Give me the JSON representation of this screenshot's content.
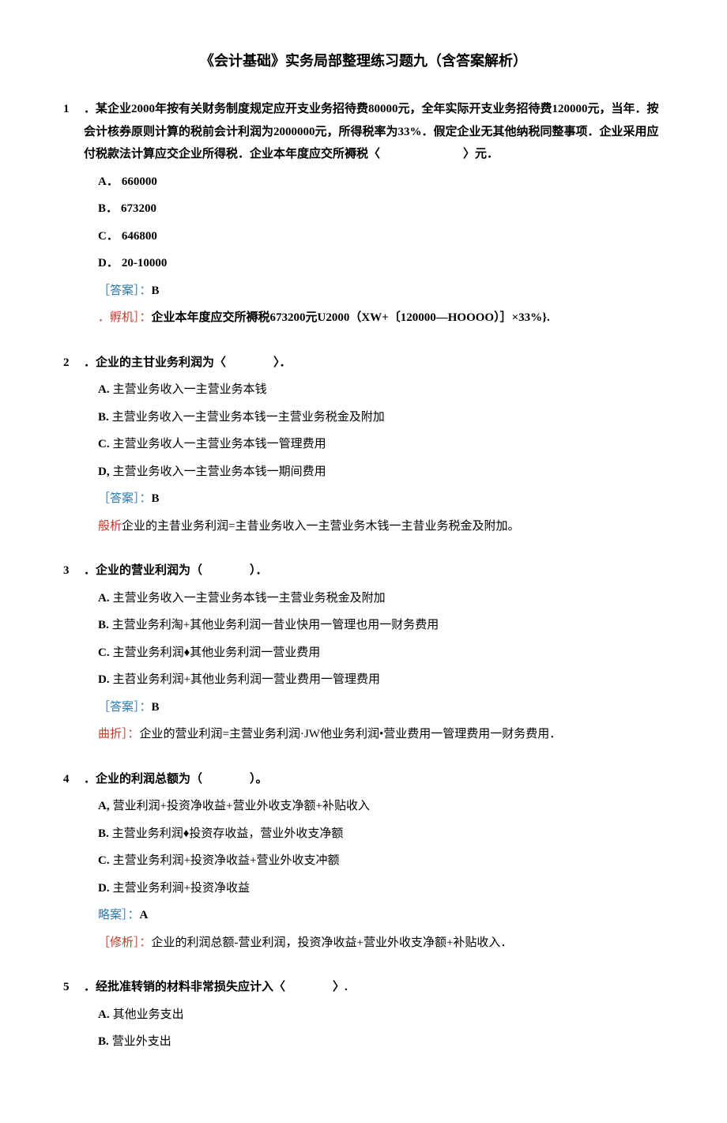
{
  "title": "《会计基础》实务局部整理练习题九（含答案解析）",
  "questions": [
    {
      "num": "1",
      "stem": "．某企业2000年按有关财务制度规定应开支业务招待费80000元，全年实际开支业务招待费120000元，当年．按会计核券原则计算的税前会计利润为2000000元，所得税率为33%．假定企业无其他纳税同整事项．企业采用应付税款法计算应交企业所得税．企业本年度应交所褥税〈　　　　　　　〉元．",
      "options": [
        {
          "label": "A．",
          "text": "660000"
        },
        {
          "label": "B．",
          "text": "673200"
        },
        {
          "label": "C．",
          "text": "646800"
        },
        {
          "label": "D．",
          "text": "20-10000"
        }
      ],
      "answer_label": "［答案］：",
      "answer": "B",
      "analysis_label": "．孵机］：",
      "analysis": "企业本年度应交所褥税673200元U2000（XW+〔120000—HOOOO）］×33%}."
    },
    {
      "num": "2",
      "stem": "．企业的主甘业务利润为〈　　　　〉．",
      "options": [
        {
          "label": "A.",
          "text": "主营业务收入一主营业务本钱"
        },
        {
          "label": "B.",
          "text": "主营业务收入一主营业务本钱一主营业务税金及附加"
        },
        {
          "label": "C.",
          "text": "主营业务收人一主营业务本钱一管理费用"
        },
        {
          "label": "D,",
          "text": "主营业务收入一主营业务本钱一期间费用"
        }
      ],
      "answer_label": "［答案］：",
      "answer": "B",
      "analysis_label": "般析",
      "analysis": "企业的主昔业务利润=主昔业务收入一主营业务木钱一主昔业务税金及附加。"
    },
    {
      "num": "3",
      "stem": "．企业的营业利润为（　　　　）．",
      "options": [
        {
          "label": "A.",
          "text": "主营业务收入一主营业务本钱一主营业务税金及附加"
        },
        {
          "label": "B.",
          "text": "主营业务利淘+其他业务利润一昔业快用一管理也用一财务费用"
        },
        {
          "label": "C.",
          "text": "主营业务利润♦其他业务利润一营业费用"
        },
        {
          "label": "D.",
          "text": "主苕业务利润+其他业务利润一营业费用一管理费用"
        }
      ],
      "answer_label": "［答案］：",
      "answer": "B",
      "analysis_label": "曲折］：",
      "analysis": "企业的营业利润=主营业务利润·JW他业务利润•营业费用一管理费用一财务费用．"
    },
    {
      "num": "4",
      "stem": "．企业的利润总额为（　　　　）。",
      "options": [
        {
          "label": "A,",
          "text": "营业利润+投资净收益+营业外收支净额+补贴收入"
        },
        {
          "label": "B.",
          "text": "主营业务利润♦投资存收益，营业外收支净额"
        },
        {
          "label": "C.",
          "text": "主营业务利润+投资净收益+营业外收支冲额"
        },
        {
          "label": "D.",
          "text": "主营业务利涧+投资净收益"
        }
      ],
      "answer_label": "略案］：",
      "answer": "A",
      "analysis_label": "［修析］：",
      "analysis": "企业的利润总额-营业利润，投资净收益+营业外收支净额+补贴收入．"
    },
    {
      "num": "5",
      "stem": "．经批准转销的材料非常损失应计入〈　　　　〉.",
      "options": [
        {
          "label": "A.",
          "text": "其他业务支出"
        },
        {
          "label": "B.",
          "text": "营业外支出"
        }
      ]
    }
  ]
}
